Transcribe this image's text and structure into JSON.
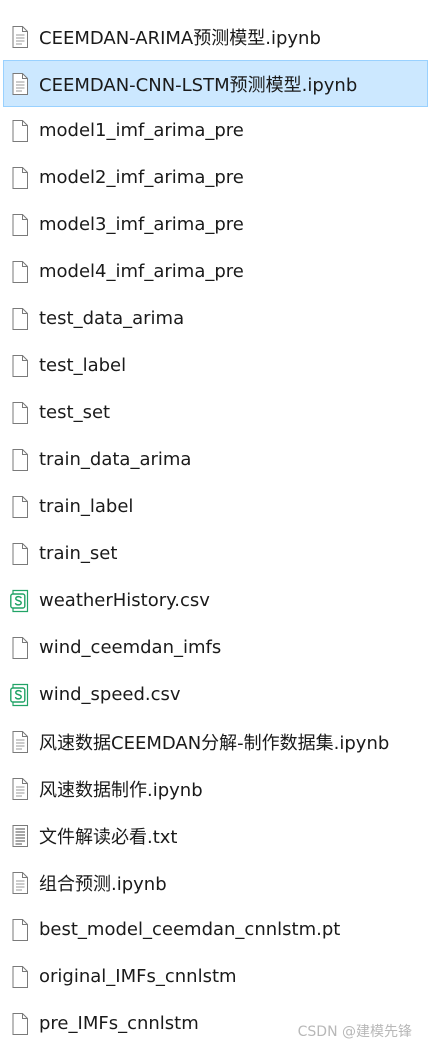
{
  "files": [
    {
      "name": "CEEMDAN-ARIMA预测模型.ipynb",
      "icon": "notebook-file-icon",
      "selected": false
    },
    {
      "name": "CEEMDAN-CNN-LSTM预测模型.ipynb",
      "icon": "notebook-file-icon",
      "selected": true
    },
    {
      "name": "model1_imf_arima_pre",
      "icon": "blank-file-icon",
      "selected": false
    },
    {
      "name": "model2_imf_arima_pre",
      "icon": "blank-file-icon",
      "selected": false
    },
    {
      "name": "model3_imf_arima_pre",
      "icon": "blank-file-icon",
      "selected": false
    },
    {
      "name": "model4_imf_arima_pre",
      "icon": "blank-file-icon",
      "selected": false
    },
    {
      "name": "test_data_arima",
      "icon": "blank-file-icon",
      "selected": false
    },
    {
      "name": "test_label",
      "icon": "blank-file-icon",
      "selected": false
    },
    {
      "name": "test_set",
      "icon": "blank-file-icon",
      "selected": false
    },
    {
      "name": "train_data_arima",
      "icon": "blank-file-icon",
      "selected": false
    },
    {
      "name": "train_label",
      "icon": "blank-file-icon",
      "selected": false
    },
    {
      "name": "train_set",
      "icon": "blank-file-icon",
      "selected": false
    },
    {
      "name": "weatherHistory.csv",
      "icon": "csv-file-icon",
      "selected": false
    },
    {
      "name": "wind_ceemdan_imfs",
      "icon": "blank-file-icon",
      "selected": false
    },
    {
      "name": "wind_speed.csv",
      "icon": "csv-file-icon",
      "selected": false
    },
    {
      "name": "风速数据CEEMDAN分解-制作数据集.ipynb",
      "icon": "notebook-file-icon",
      "selected": false
    },
    {
      "name": "风速数据制作.ipynb",
      "icon": "notebook-file-icon",
      "selected": false
    },
    {
      "name": "文件解读必看.txt",
      "icon": "text-file-icon",
      "selected": false
    },
    {
      "name": "组合预测.ipynb",
      "icon": "notebook-file-icon",
      "selected": false
    },
    {
      "name": "best_model_ceemdan_cnnlstm.pt",
      "icon": "blank-file-icon",
      "selected": false
    },
    {
      "name": "original_IMFs_cnnlstm",
      "icon": "blank-file-icon",
      "selected": false
    },
    {
      "name": "pre_IMFs_cnnlstm",
      "icon": "blank-file-icon",
      "selected": false
    }
  ],
  "watermark": "CSDN @建模先锋",
  "colors": {
    "selection_bg": "#cce8ff",
    "selection_border": "#99d1ff",
    "csv_icon_green": "#21a366"
  }
}
